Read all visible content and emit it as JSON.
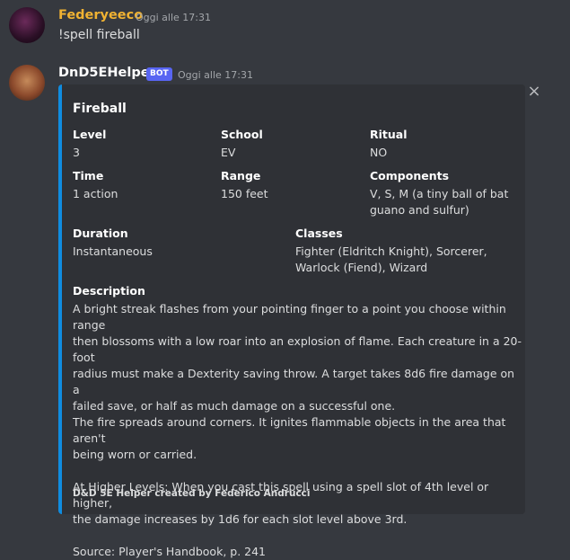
{
  "message1": {
    "username": "Federyeeco",
    "timestamp": "Oggi alle 17:31",
    "content": "!spell fireball"
  },
  "message2": {
    "username": "DnD5EHelper",
    "badge": "BOT",
    "timestamp": "Oggi alle 17:31"
  },
  "embed": {
    "accent_color": "#0f8ce0",
    "title": "Fireball",
    "close_icon": "×",
    "fields": {
      "level": {
        "name": "Level",
        "value": "3"
      },
      "school": {
        "name": "School",
        "value": "EV"
      },
      "ritual": {
        "name": "Ritual",
        "value": "NO"
      },
      "time": {
        "name": "Time",
        "value": "1 action"
      },
      "range": {
        "name": "Range",
        "value": "150 feet"
      },
      "components": {
        "name": "Components",
        "value_line1": "V, S, M (a tiny ball of bat",
        "value_line2": "guano and sulfur)"
      },
      "duration": {
        "name": "Duration",
        "value": "Instantaneous"
      },
      "classes": {
        "name": "Classes",
        "value_line1": "Fighter (Eldritch Knight), Sorcerer,",
        "value_line2": "Warlock (Fiend), Wizard"
      }
    },
    "description": {
      "name": "Description",
      "lines": [
        "A bright streak flashes from your pointing finger to a point you choose within range",
        "then blossoms with a low roar into an explosion of flame. Each creature in a 20-foot",
        "radius must make a Dexterity saving throw. A target takes 8d6 fire damage on a",
        "failed save, or half as much damage on a successful one.",
        "The fire spreads around corners. It ignites flammable objects in the area that aren't",
        "being worn or carried.",
        "",
        "At Higher Levels: When you cast this spell using a spell slot of 4th level or higher,",
        "the damage increases by 1d6 for each slot level above 3rd.",
        "",
        "Source: Player's Handbook, p. 241"
      ]
    },
    "footer": "D&D 5E Helper created by Federico Andrucci"
  }
}
